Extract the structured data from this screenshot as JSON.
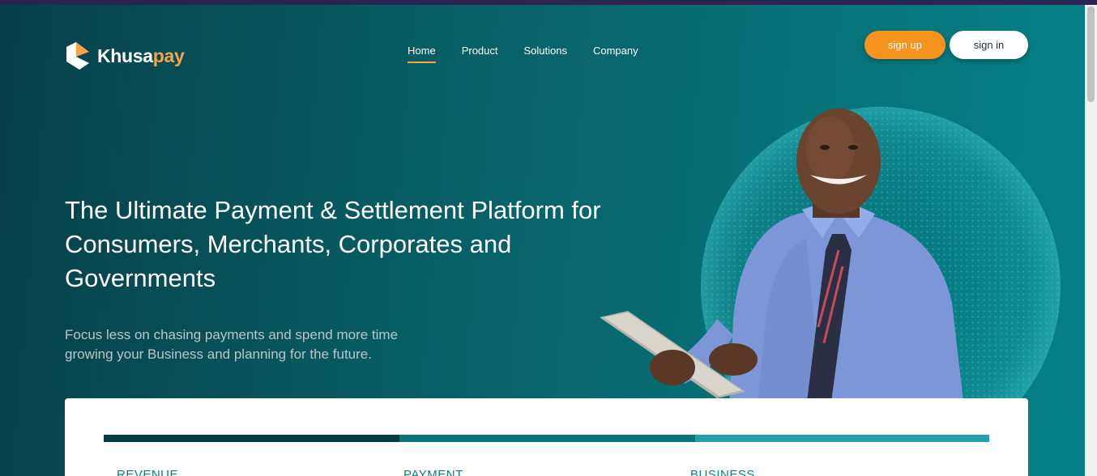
{
  "logo": {
    "part1": "Khusa",
    "part2": "pay"
  },
  "nav": {
    "items": [
      {
        "label": "Home",
        "active": true
      },
      {
        "label": "Product",
        "active": false
      },
      {
        "label": "Solutions",
        "active": false
      },
      {
        "label": "Company",
        "active": false
      }
    ]
  },
  "auth": {
    "signup_label": "sign up",
    "signin_label": "sign in"
  },
  "hero": {
    "headline": "The Ultimate Payment & Settlement Platform for Consumers, Merchants, Corporates and Governments",
    "subtext": "Focus less on chasing payments and spend more time growing your Business and planning for the future."
  },
  "card": {
    "labels": [
      "REVENUE",
      "PAYMENT",
      "BUSINESS"
    ]
  },
  "colors": {
    "accent": "#f7941d",
    "brand_dark": "#053a42",
    "brand_mid": "#08757c",
    "brand_light": "#21a3ad"
  },
  "icons": {
    "logo": "khusapay-logo-icon"
  }
}
